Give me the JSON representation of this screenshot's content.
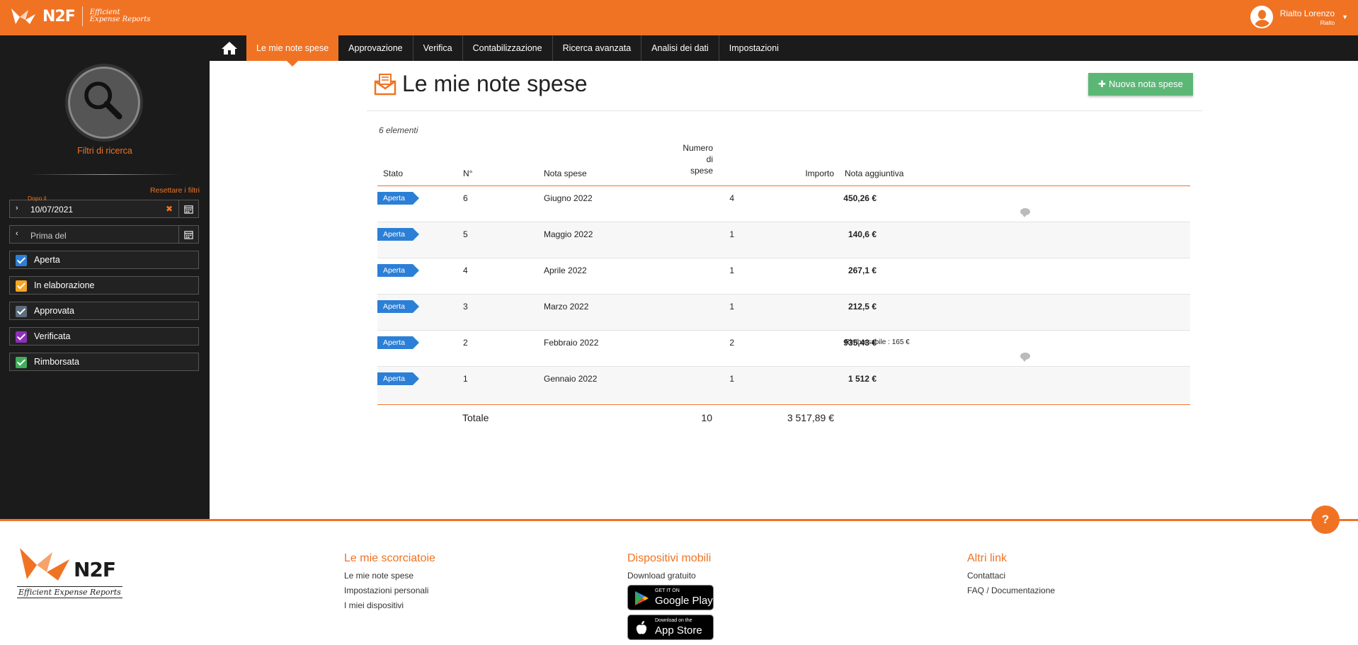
{
  "header": {
    "logo_word": "N2F",
    "logo_tagline_1": "Efficient",
    "logo_tagline_2": "Expense Reports",
    "user_name": "Rialto Lorenzo",
    "user_company": "Rialto"
  },
  "nav": {
    "items": [
      {
        "label": "Le mie note spese",
        "active": true
      },
      {
        "label": "Approvazione"
      },
      {
        "label": "Verifica"
      },
      {
        "label": "Contabilizzazione"
      },
      {
        "label": "Ricerca avanzata"
      },
      {
        "label": "Analisi dei dati"
      },
      {
        "label": "Impostazioni"
      }
    ]
  },
  "sidebar": {
    "filter_title": "Filtri di ricerca",
    "reset_label": "Resettare i filtri",
    "after_label": "Dopo il",
    "after_value": "10/07/2021",
    "before_placeholder": "Prima del",
    "statuses": [
      {
        "label": "Aperta",
        "color": "#2c7fd6"
      },
      {
        "label": "In elaborazione",
        "color": "#f5a623"
      },
      {
        "label": "Approvata",
        "color": "#5d6d7e"
      },
      {
        "label": "Verificata",
        "color": "#8e2fb8"
      },
      {
        "label": "Rimborsata",
        "color": "#3fae5a"
      }
    ]
  },
  "main": {
    "title": "Le mie note spese",
    "new_button": "Nuova nota spese",
    "count": "6 elementi",
    "columns": {
      "stato": "Stato",
      "n": "N°",
      "nota": "Nota spese",
      "numero_1": "Numero",
      "numero_2": "di",
      "numero_3": "spese",
      "importo": "Importo",
      "aggiuntiva": "Nota aggiuntiva"
    },
    "rows": [
      {
        "stato": "Aperta",
        "n": "6",
        "nota": "Giugno 2022",
        "numero": "4",
        "importo": "450,26 €",
        "aggiuntiva": "",
        "comment": true
      },
      {
        "stato": "Aperta",
        "n": "5",
        "nota": "Maggio 2022",
        "numero": "1",
        "importo": "140,6 €",
        "aggiuntiva": "",
        "comment": false
      },
      {
        "stato": "Aperta",
        "n": "4",
        "nota": "Aprile 2022",
        "numero": "1",
        "importo": "267,1 €",
        "aggiuntiva": "",
        "comment": false
      },
      {
        "stato": "Aperta",
        "n": "3",
        "nota": "Marzo 2022",
        "numero": "1",
        "importo": "212,5 €",
        "aggiuntiva": "",
        "comment": false
      },
      {
        "stato": "Aperta",
        "n": "2",
        "nota": "Febbraio 2022",
        "numero": "2",
        "importo": "935,43 €",
        "aggiuntiva": "Rimborsabile : 165 €",
        "comment": true
      },
      {
        "stato": "Aperta",
        "n": "1",
        "nota": "Gennaio 2022",
        "numero": "1",
        "importo": "1 512 €",
        "aggiuntiva": "",
        "comment": false
      }
    ],
    "total_label": "Totale",
    "total_count": "10",
    "total_amount": "3 517,89 €"
  },
  "footer": {
    "logo_word": "N2F",
    "logo_tagline": "Efficient Expense Reports",
    "shortcuts_title": "Le mie scorciatoie",
    "shortcuts": [
      "Le mie note spese",
      "Impostazioni personali",
      "I miei dispositivi"
    ],
    "mobile_title": "Dispositivi mobili",
    "mobile_sub": "Download gratuito",
    "google_small": "GET IT ON",
    "google_big": "Google Play",
    "apple_small": "Download on the",
    "apple_big": "App Store",
    "links_title": "Altri link",
    "links": [
      "Contattaci",
      "FAQ / Documentazione"
    ],
    "help": "?"
  }
}
